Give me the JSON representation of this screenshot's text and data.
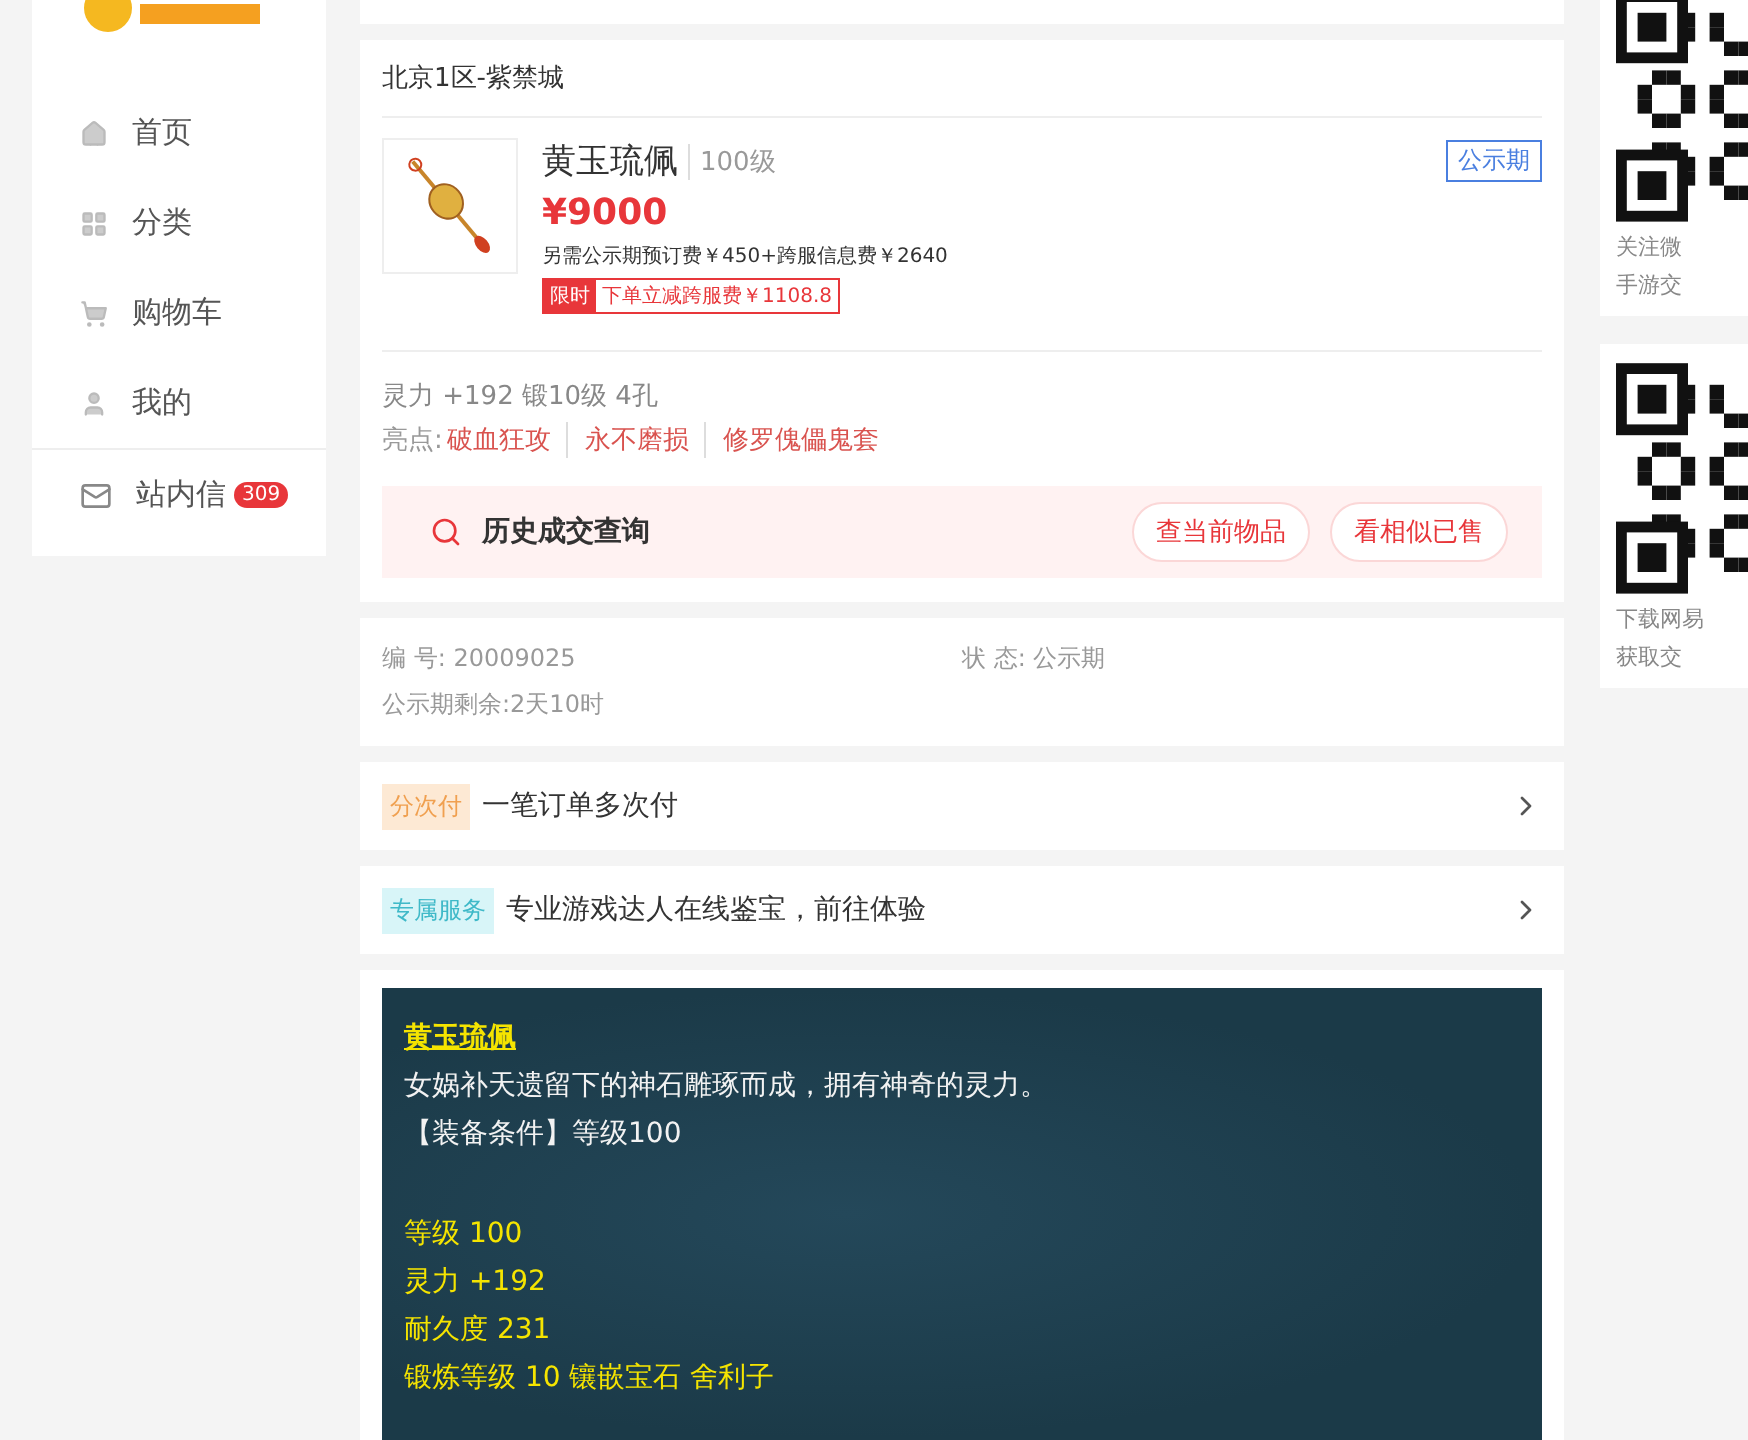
{
  "sidebar": {
    "items": [
      {
        "label": "首页",
        "kind": "home",
        "selected": false
      },
      {
        "label": "分类",
        "kind": "category",
        "selected": false
      },
      {
        "label": "购物车",
        "kind": "cart",
        "selected": false
      },
      {
        "label": "我的",
        "kind": "user",
        "selected": false
      }
    ],
    "messages": {
      "label": "站内信",
      "badge": "309"
    }
  },
  "listing": {
    "server": "北京1区-紫禁城",
    "name": "黄玉琉佩",
    "level": "100级",
    "status_tag": "公示期",
    "price": "¥9000",
    "fees": "另需公示期预订费￥450+跨服信息费￥2640",
    "promo_tag": "限时",
    "promo_text": "下单立减跨服费￥1108.8",
    "stats": "灵力 +192 锻10级 4孔",
    "highlights_label": "亮点:",
    "highlights": [
      "破血狂攻",
      "永不磨损",
      "修罗傀儡鬼套"
    ],
    "history": {
      "title": "历史成交查询",
      "buttons": [
        "查当前物品",
        "看相似已售"
      ]
    }
  },
  "info": {
    "id_label": "编 号:",
    "id": "20009025",
    "status_label": "状 态:",
    "status": "公示期",
    "remaining_label": "公示期剩余:",
    "remaining": "2天10时"
  },
  "services": [
    {
      "tag": "分次付",
      "kind": "orange",
      "text": "一笔订单多次付"
    },
    {
      "tag": "专属服务",
      "kind": "teal",
      "text": "专业游戏达人在线鉴宝，前往体验"
    }
  ],
  "description": {
    "title": "黄玉琉佩",
    "lines": [
      {
        "text": "女娲补天遗留下的神石雕琢而成，拥有神奇的灵力。",
        "kind": "white"
      },
      {
        "text": "【装备条件】等级100",
        "kind": "white"
      }
    ],
    "attributes": [
      "等级 100",
      "灵力 +192",
      "耐久度 231",
      "锻炼等级 10 镶嵌宝石 舍利子"
    ]
  },
  "right_panel": [
    {
      "caption": [
        "关注微",
        "手游交"
      ]
    },
    {
      "caption": [
        "下载网易",
        "获取交"
      ]
    }
  ]
}
